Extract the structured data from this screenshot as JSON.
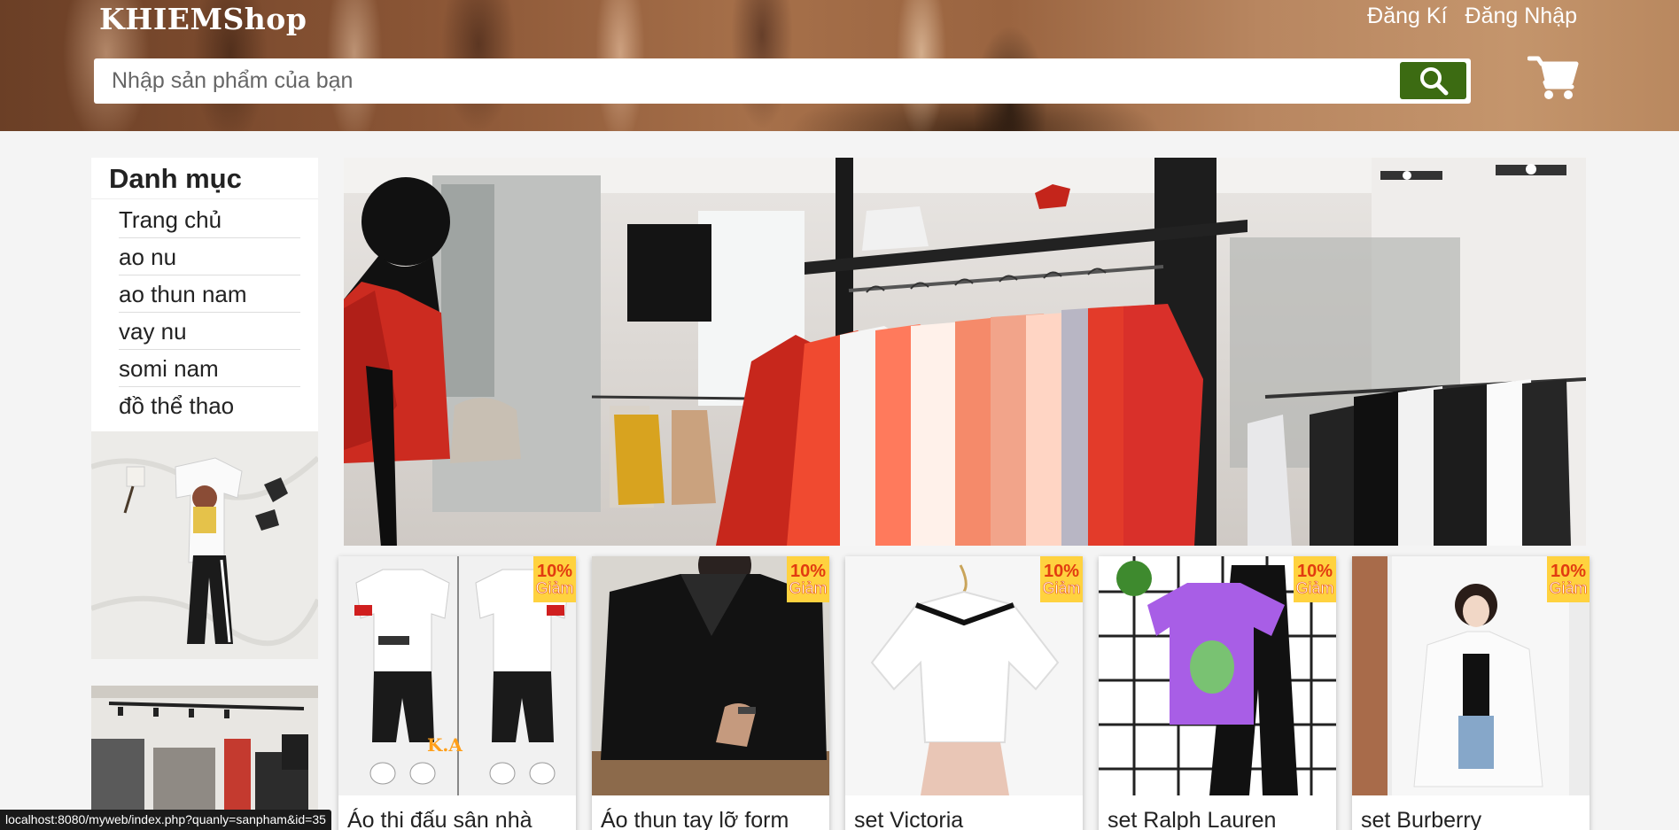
{
  "header": {
    "logo": "KHIEMShop",
    "register_label": "Đăng Kí",
    "login_label": "Đăng Nhập",
    "search_placeholder": "Nhập sản phẩm của bạn"
  },
  "sidebar": {
    "title": "Danh mục",
    "items": [
      "Trang chủ",
      "ao nu",
      "ao thun nam",
      "vay nu",
      "somi nam",
      "đồ thể thao"
    ]
  },
  "products": [
    {
      "name": "Áo thi đấu sân nhà",
      "discount": "10%",
      "discount_label": "Giảm"
    },
    {
      "name": "Áo thun tay lỡ form",
      "discount": "10%",
      "discount_label": "Giảm"
    },
    {
      "name": "set Victoria",
      "discount": "10%",
      "discount_label": "Giảm"
    },
    {
      "name": "set Ralph Lauren",
      "discount": "10%",
      "discount_label": "Giảm"
    },
    {
      "name": "set Burberry",
      "discount": "10%",
      "discount_label": "Giảm"
    }
  ],
  "status_bar": "localhost:8080/myweb/index.php?quanly=sanpham&id=35",
  "icons": {
    "search": "search-icon",
    "cart": "cart-icon"
  },
  "colors": {
    "search_button": "#3c6b12",
    "badge": "#ffd23f",
    "badge_text": "#e23b10"
  }
}
